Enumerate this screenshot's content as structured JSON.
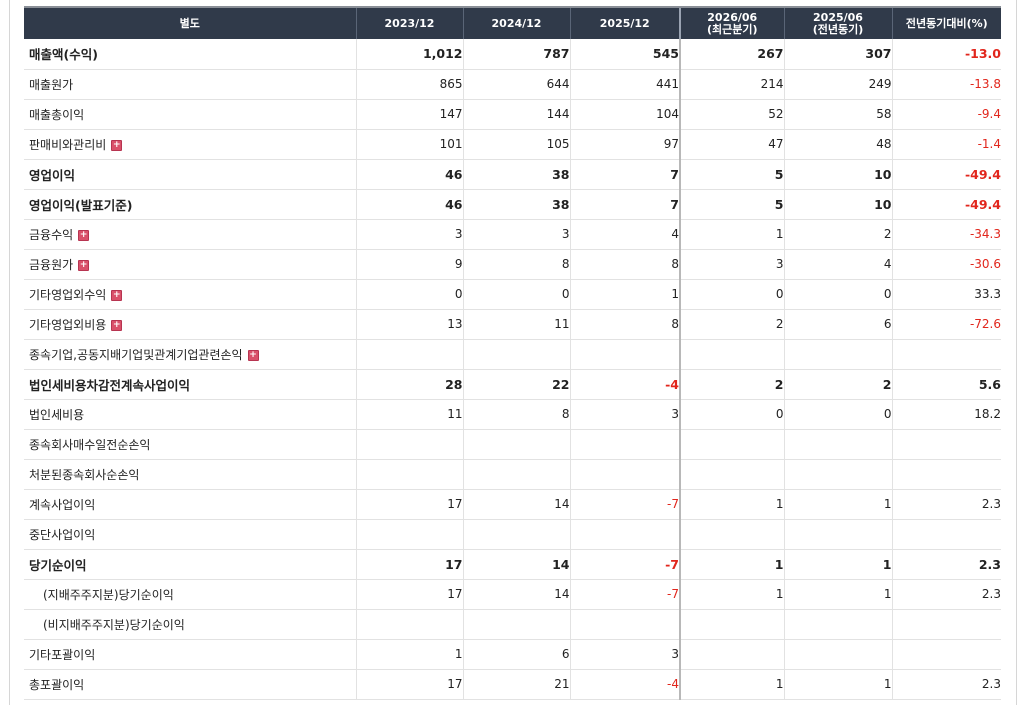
{
  "header": {
    "category": "별도",
    "cols": [
      "2023/12",
      "2024/12",
      "2025/12",
      "2026/06",
      "2025/06",
      "전년동기대비(%)"
    ],
    "col4_sub": "(최근분기)",
    "col5_sub": "(전년동기)"
  },
  "colors": {
    "header_bg": "#303a4a",
    "negative": "#e1261c"
  },
  "rows": [
    {
      "label": "매출액(수익)",
      "bold": true,
      "v": [
        "1,012",
        "787",
        "545",
        "267",
        "307",
        "-13.0"
      ]
    },
    {
      "label": "매출원가",
      "v": [
        "865",
        "644",
        "441",
        "214",
        "249",
        "-13.8"
      ]
    },
    {
      "label": "매출총이익",
      "v": [
        "147",
        "144",
        "104",
        "52",
        "58",
        "-9.4"
      ]
    },
    {
      "label": "판매비와관리비",
      "expand": true,
      "v": [
        "101",
        "105",
        "97",
        "47",
        "48",
        "-1.4"
      ]
    },
    {
      "label": "영업이익",
      "bold": true,
      "v": [
        "46",
        "38",
        "7",
        "5",
        "10",
        "-49.4"
      ]
    },
    {
      "label": "영업이익(발표기준)",
      "bold": true,
      "v": [
        "46",
        "38",
        "7",
        "5",
        "10",
        "-49.4"
      ]
    },
    {
      "label": "금융수익",
      "expand": true,
      "v": [
        "3",
        "3",
        "4",
        "1",
        "2",
        "-34.3"
      ]
    },
    {
      "label": "금융원가",
      "expand": true,
      "v": [
        "9",
        "8",
        "8",
        "3",
        "4",
        "-30.6"
      ]
    },
    {
      "label": "기타영업외수익",
      "expand": true,
      "v": [
        "0",
        "0",
        "1",
        "0",
        "0",
        "33.3"
      ]
    },
    {
      "label": "기타영업외비용",
      "expand": true,
      "v": [
        "13",
        "11",
        "8",
        "2",
        "6",
        "-72.6"
      ]
    },
    {
      "label": "종속기업,공동지배기업및관계기업관련손익",
      "expand": true,
      "v": [
        "",
        "",
        "",
        "",
        "",
        ""
      ]
    },
    {
      "label": "법인세비용차감전계속사업이익",
      "bold": true,
      "v": [
        "28",
        "22",
        "-4",
        "2",
        "2",
        "5.6"
      ]
    },
    {
      "label": "법인세비용",
      "v": [
        "11",
        "8",
        "3",
        "0",
        "0",
        "18.2"
      ]
    },
    {
      "label": "종속회사매수일전순손익",
      "v": [
        "",
        "",
        "",
        "",
        "",
        ""
      ]
    },
    {
      "label": "처분된종속회사순손익",
      "v": [
        "",
        "",
        "",
        "",
        "",
        ""
      ]
    },
    {
      "label": "계속사업이익",
      "v": [
        "17",
        "14",
        "-7",
        "1",
        "1",
        "2.3"
      ]
    },
    {
      "label": "중단사업이익",
      "v": [
        "",
        "",
        "",
        "",
        "",
        ""
      ]
    },
    {
      "label": "당기순이익",
      "bold": true,
      "v": [
        "17",
        "14",
        "-7",
        "1",
        "1",
        "2.3"
      ]
    },
    {
      "label": "(지배주주지분)당기순이익",
      "indent": true,
      "v": [
        "17",
        "14",
        "-7",
        "1",
        "1",
        "2.3"
      ]
    },
    {
      "label": "(비지배주주지분)당기순이익",
      "indent": true,
      "v": [
        "",
        "",
        "",
        "",
        "",
        ""
      ]
    },
    {
      "label": "기타포괄이익",
      "v": [
        "1",
        "6",
        "3",
        "",
        "",
        ""
      ]
    },
    {
      "label": "총포괄이익",
      "v": [
        "17",
        "21",
        "-4",
        "1",
        "1",
        "2.3"
      ]
    }
  ]
}
